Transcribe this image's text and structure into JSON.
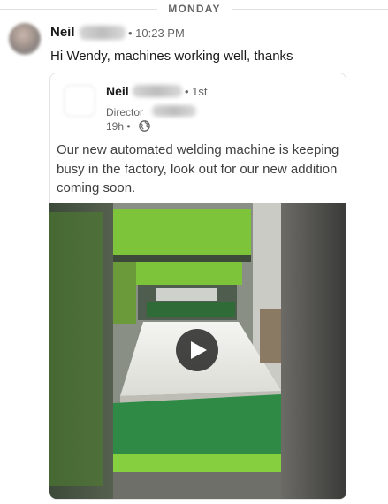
{
  "divider": {
    "day_label": "MONDAY"
  },
  "message": {
    "sender_first_name": "Neil",
    "timestamp": "• 10:23 PM",
    "text": "Hi Wendy, machines working well, thanks"
  },
  "shared_post": {
    "author_first_name": "Neil",
    "connection_degree": "• 1st",
    "author_title_prefix": "Director",
    "posted_time": "19h •",
    "visibility_icon": "globe-icon",
    "text": "Our new automated welding machine is keeping busy in the factory, look out for our new addition coming soon.",
    "media": {
      "type": "video",
      "control_icon": "play-icon"
    }
  },
  "colors": {
    "text_primary": "#191919",
    "text_secondary": "#666666",
    "machine_green": "#7dc43a",
    "play_overlay": "#1e1e1e"
  }
}
